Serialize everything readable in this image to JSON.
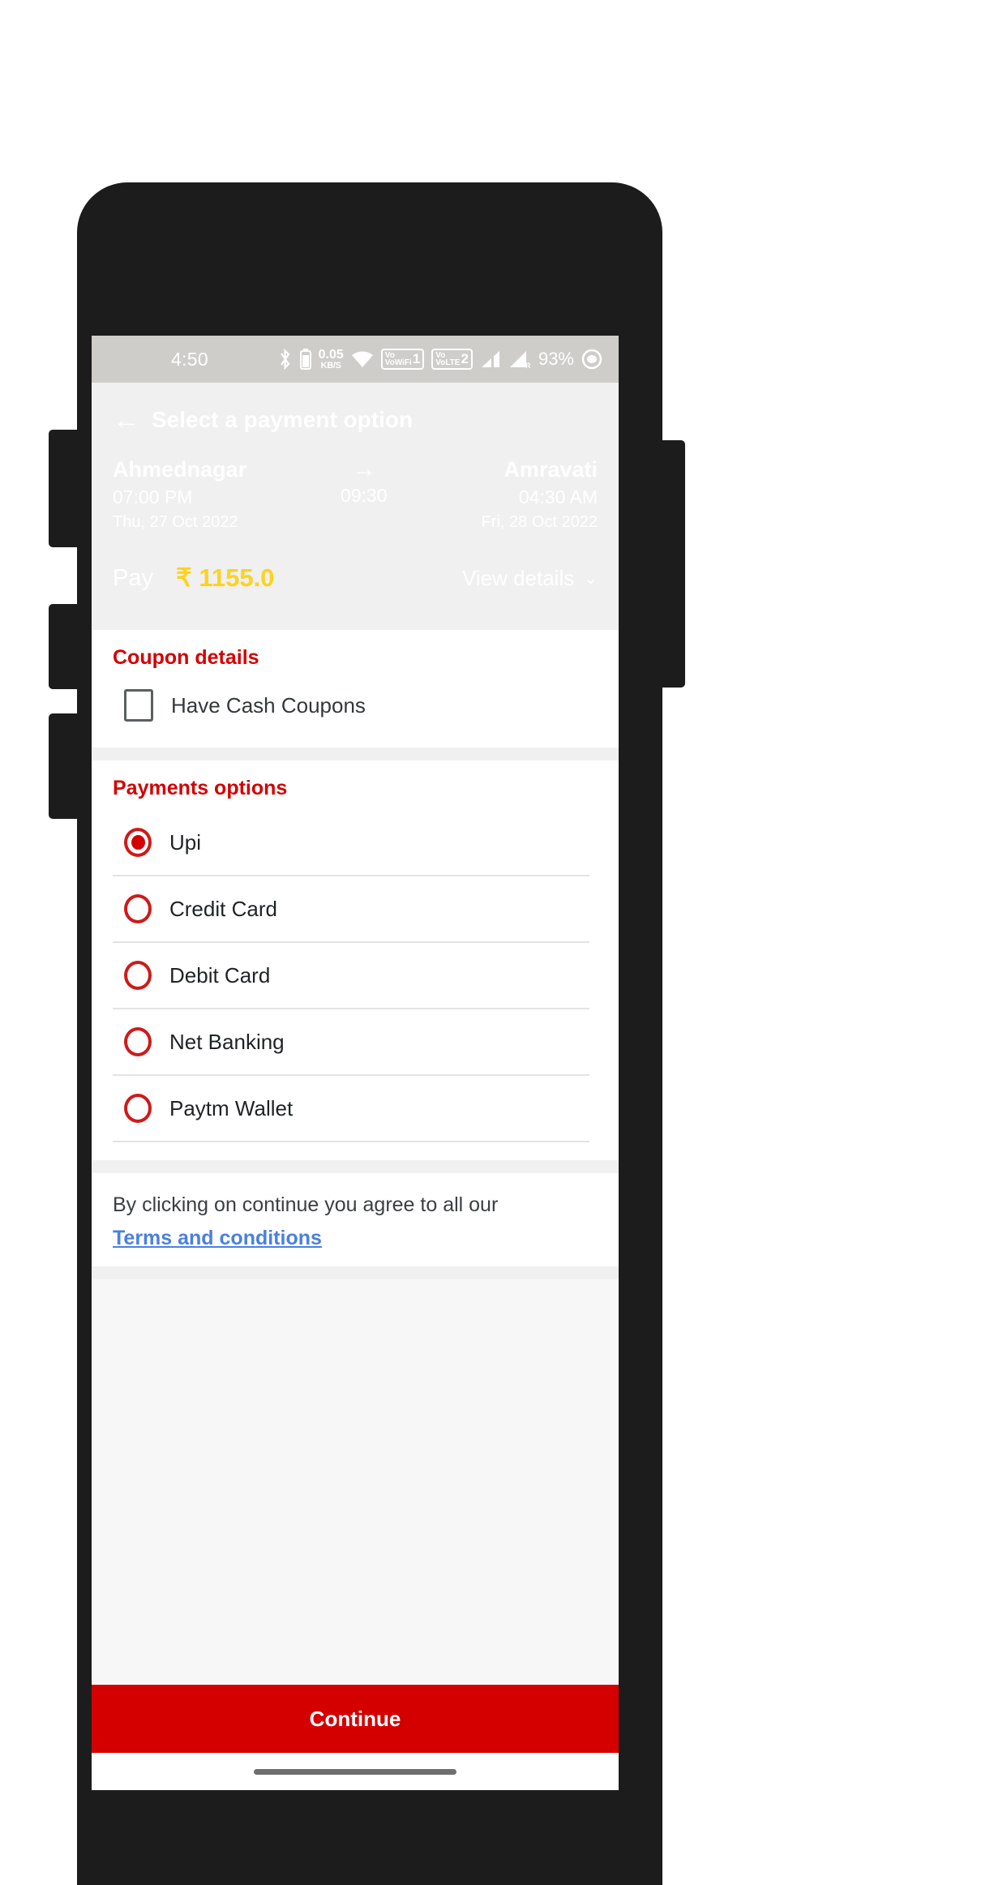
{
  "status_bar": {
    "time": "4:50",
    "data_rate_value": "0.05",
    "data_rate_unit": "KB/S",
    "vowifi_label": "VoWiFi",
    "vowifi_sim": "1",
    "volte_label": "VoLTE",
    "volte_sim": "2",
    "roaming_letter": "R",
    "battery_percent": "93%"
  },
  "app_bar": {
    "back_icon": "back-arrow-icon",
    "title": "Select a payment option"
  },
  "trip": {
    "source_city": "Ahmednagar",
    "source_time": "07:00 PM",
    "source_date": "Thu, 27 Oct 2022",
    "arrow_icon": "arrow-right-icon",
    "duration": "09:30",
    "destination_city": "Amravati",
    "destination_time": "04:30 AM",
    "destination_date": "Fri, 28 Oct 2022",
    "pay_label": "Pay",
    "pay_amount": "₹ 1155.0",
    "view_details_label": "View details",
    "view_details_chevron": "⌄",
    "amount_color": "#ffd21e"
  },
  "coupon": {
    "section_title": "Coupon details",
    "checkbox_label": "Have Cash Coupons",
    "checked": false
  },
  "payments": {
    "section_title": "Payments options",
    "accent_color": "#d40000",
    "options": [
      {
        "label": "Upi",
        "selected": true
      },
      {
        "label": "Credit Card",
        "selected": false
      },
      {
        "label": "Debit Card",
        "selected": false
      },
      {
        "label": "Net Banking",
        "selected": false
      },
      {
        "label": "Paytm Wallet",
        "selected": false
      }
    ]
  },
  "terms": {
    "text": "By clicking on continue you agree to all our",
    "link_label": "Terms and conditions",
    "link_color": "#4a80e0"
  },
  "footer": {
    "continue_label": "Continue",
    "button_color": "#d40000"
  }
}
